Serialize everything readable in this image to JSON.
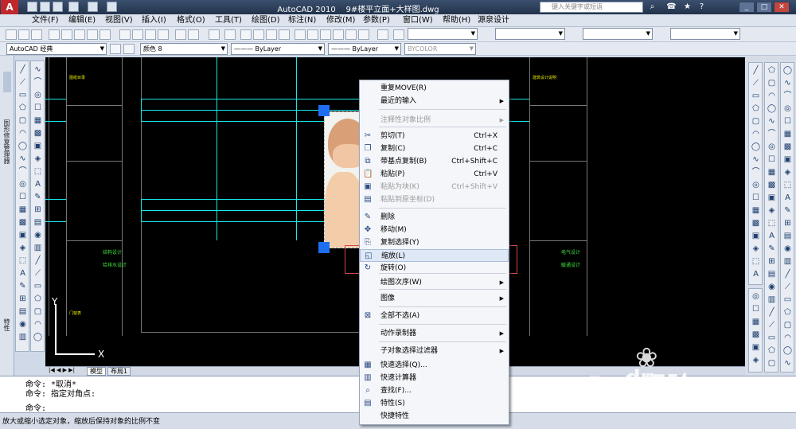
{
  "app": {
    "logo_letter": "A",
    "title": "AutoCAD 2010",
    "file": "9#楼平立面+大样图.dwg",
    "search_placeholder": "键入关键字或短语"
  },
  "menubar": [
    "文件(F)",
    "编辑(E)",
    "视图(V)",
    "插入(I)",
    "格式(O)",
    "工具(T)",
    "绘图(D)",
    "标注(N)",
    "修改(M)",
    "参数(P)",
    "窗口(W)",
    "帮助(H)",
    "源泉设计"
  ],
  "toolbar2": {
    "workspace": "AutoCAD 经典",
    "color": "颜色 8",
    "linetype": "ByLayer",
    "lineweight": "ByLayer",
    "plotstyle": "BYCOLOR"
  },
  "left_palette": {
    "label1": "图形修复管理器",
    "label2": "特性"
  },
  "canvas": {
    "ucs_x": "X",
    "ucs_y": "Y",
    "table_rows_labels": [
      "图纸目录",
      "建筑设计说明",
      "门窗表"
    ],
    "green_notes": [
      "结构设计",
      "给排水设计",
      "电气设计",
      "暖通设计"
    ]
  },
  "tabs": {
    "model": "模型",
    "layout": "布局1"
  },
  "command": {
    "prefix": "命令:",
    "lines": [
      "命令: *取消*",
      "命令: 指定对角点:"
    ]
  },
  "status": {
    "text": "放大或缩小选定对象，缩放后保持对象的比例不变"
  },
  "context_menu": [
    {
      "label": "重复MOVE(R)",
      "shortcut": "",
      "submenu": false,
      "disabled": false,
      "icon": ""
    },
    {
      "label": "最近的输入",
      "shortcut": "",
      "submenu": true,
      "disabled": false,
      "icon": ""
    },
    {
      "label": "注释性对象比例",
      "shortcut": "",
      "submenu": true,
      "disabled": true,
      "icon": ""
    },
    {
      "label": "剪切(T)",
      "shortcut": "Ctrl+X",
      "submenu": false,
      "disabled": false,
      "icon": "✂"
    },
    {
      "label": "复制(C)",
      "shortcut": "Ctrl+C",
      "submenu": false,
      "disabled": false,
      "icon": "❐"
    },
    {
      "label": "带基点复制(B)",
      "shortcut": "Ctrl+Shift+C",
      "submenu": false,
      "disabled": false,
      "icon": "⧉"
    },
    {
      "label": "粘贴(P)",
      "shortcut": "Ctrl+V",
      "submenu": false,
      "disabled": false,
      "icon": "📋"
    },
    {
      "label": "粘贴为块(K)",
      "shortcut": "Ctrl+Shift+V",
      "submenu": false,
      "disabled": true,
      "icon": "▣"
    },
    {
      "label": "粘贴到原坐标(D)",
      "shortcut": "",
      "submenu": false,
      "disabled": true,
      "icon": "▤"
    },
    {
      "label": "删除",
      "shortcut": "",
      "submenu": false,
      "disabled": false,
      "icon": "✎"
    },
    {
      "label": "移动(M)",
      "shortcut": "",
      "submenu": false,
      "disabled": false,
      "icon": "✥"
    },
    {
      "label": "复制选择(Y)",
      "shortcut": "",
      "submenu": false,
      "disabled": false,
      "icon": "⎘"
    },
    {
      "label": "缩放(L)",
      "shortcut": "",
      "submenu": false,
      "disabled": false,
      "icon": "◱"
    },
    {
      "label": "旋转(O)",
      "shortcut": "",
      "submenu": false,
      "disabled": false,
      "icon": "↻"
    },
    {
      "label": "绘图次序(W)",
      "shortcut": "",
      "submenu": true,
      "disabled": false,
      "icon": ""
    },
    {
      "label": "图像",
      "shortcut": "",
      "submenu": true,
      "disabled": false,
      "icon": ""
    },
    {
      "label": "全部不选(A)",
      "shortcut": "",
      "submenu": false,
      "disabled": false,
      "icon": "⊠"
    },
    {
      "label": "动作录制器",
      "shortcut": "",
      "submenu": true,
      "disabled": false,
      "icon": ""
    },
    {
      "label": "子对象选择过滤器",
      "shortcut": "",
      "submenu": true,
      "disabled": false,
      "icon": ""
    },
    {
      "label": "快速选择(Q)...",
      "shortcut": "",
      "submenu": false,
      "disabled": false,
      "icon": "▦"
    },
    {
      "label": "快速计算器",
      "shortcut": "",
      "submenu": false,
      "disabled": false,
      "icon": "▥"
    },
    {
      "label": "查找(F)...",
      "shortcut": "",
      "submenu": false,
      "disabled": false,
      "icon": "⌕"
    },
    {
      "label": "特性(S)",
      "shortcut": "",
      "submenu": false,
      "disabled": false,
      "icon": "▤"
    },
    {
      "label": "快捷特性",
      "shortcut": "",
      "submenu": false,
      "disabled": false,
      "icon": ""
    }
  ],
  "watermark": {
    "brand": "Bai 经验",
    "paw": "du",
    "url": "jingyan.baidu.com"
  }
}
